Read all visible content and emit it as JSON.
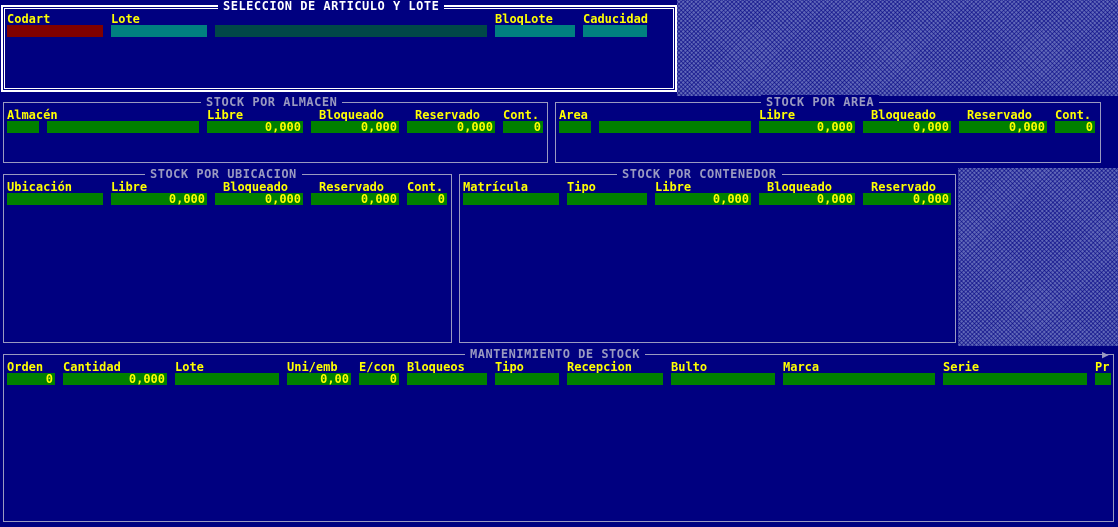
{
  "seleccion": {
    "title": "SELECCIÓN DE ARTÍCULO Y LOTE",
    "labels": {
      "codart": "Codart",
      "lote": "Lote",
      "bloqlote": "BloqLote",
      "caducidad": "Caducidad"
    },
    "values": {
      "codart": "",
      "lote": "",
      "lote_desc": "",
      "bloqlote": "",
      "caducidad": ""
    }
  },
  "almacen": {
    "title": "STOCK POR ALMACEN",
    "labels": {
      "almacen": "Almacén",
      "libre": "Libre",
      "bloqueado": "Bloqueado",
      "reservado": "Reservado",
      "cont": "Cont."
    },
    "values": {
      "almacen": "",
      "almacen_desc": "",
      "libre": "0,000",
      "bloqueado": "0,000",
      "reservado": "0,000",
      "cont": "0"
    }
  },
  "area": {
    "title": "STOCK POR AREA",
    "labels": {
      "area": "Area",
      "libre": "Libre",
      "bloqueado": "Bloqueado",
      "reservado": "Reservado",
      "cont": "Cont."
    },
    "values": {
      "area": "",
      "area_desc": "",
      "libre": "0,000",
      "bloqueado": "0,000",
      "reservado": "0,000",
      "cont": "0"
    }
  },
  "ubicacion": {
    "title": "STOCK POR UBICACION",
    "labels": {
      "ubicacion": "Ubicación",
      "libre": "Libre",
      "bloqueado": "Bloqueado",
      "reservado": "Reservado",
      "cont": "Cont."
    },
    "values": {
      "ubicacion": "",
      "libre": "0,000",
      "bloqueado": "0,000",
      "reservado": "0,000",
      "cont": "0"
    }
  },
  "contenedor": {
    "title": "STOCK POR CONTENEDOR",
    "labels": {
      "matricula": "Matrícula",
      "tipo": "Tipo",
      "libre": "Libre",
      "bloqueado": "Bloqueado",
      "reservado": "Reservado"
    },
    "values": {
      "matricula": "",
      "tipo": "",
      "libre": "0,000",
      "bloqueado": "0,000",
      "reservado": "0,000"
    }
  },
  "mantenimiento": {
    "title": "MANTENIMIENTO DE STOCK",
    "labels": {
      "orden": "Orden",
      "cantidad": "Cantidad",
      "lote": "Lote",
      "uniemb": "Uni/emb",
      "econ": "E/con",
      "bloqueos": "Bloqueos",
      "tipo": "Tipo",
      "recepcion": "Recepcion",
      "bulto": "Bulto",
      "marca": "Marca",
      "serie": "Serie",
      "pr": "Pr"
    },
    "values": {
      "orden": "0",
      "cantidad": "0,000",
      "lote": "",
      "uniemb": "0,00",
      "econ": "0",
      "bloqueos": "",
      "tipo": "",
      "recepcion": "",
      "bulto": "",
      "marca": "",
      "serie": "",
      "pr": ""
    }
  },
  "icons": {
    "scroll_right": "right-triangle-arrow"
  },
  "colors": {
    "background": "#000080",
    "label": "#ffff00",
    "field": "#008000",
    "field_red": "#800000",
    "field_teal": "#008080",
    "border": "#9a9ac0"
  }
}
